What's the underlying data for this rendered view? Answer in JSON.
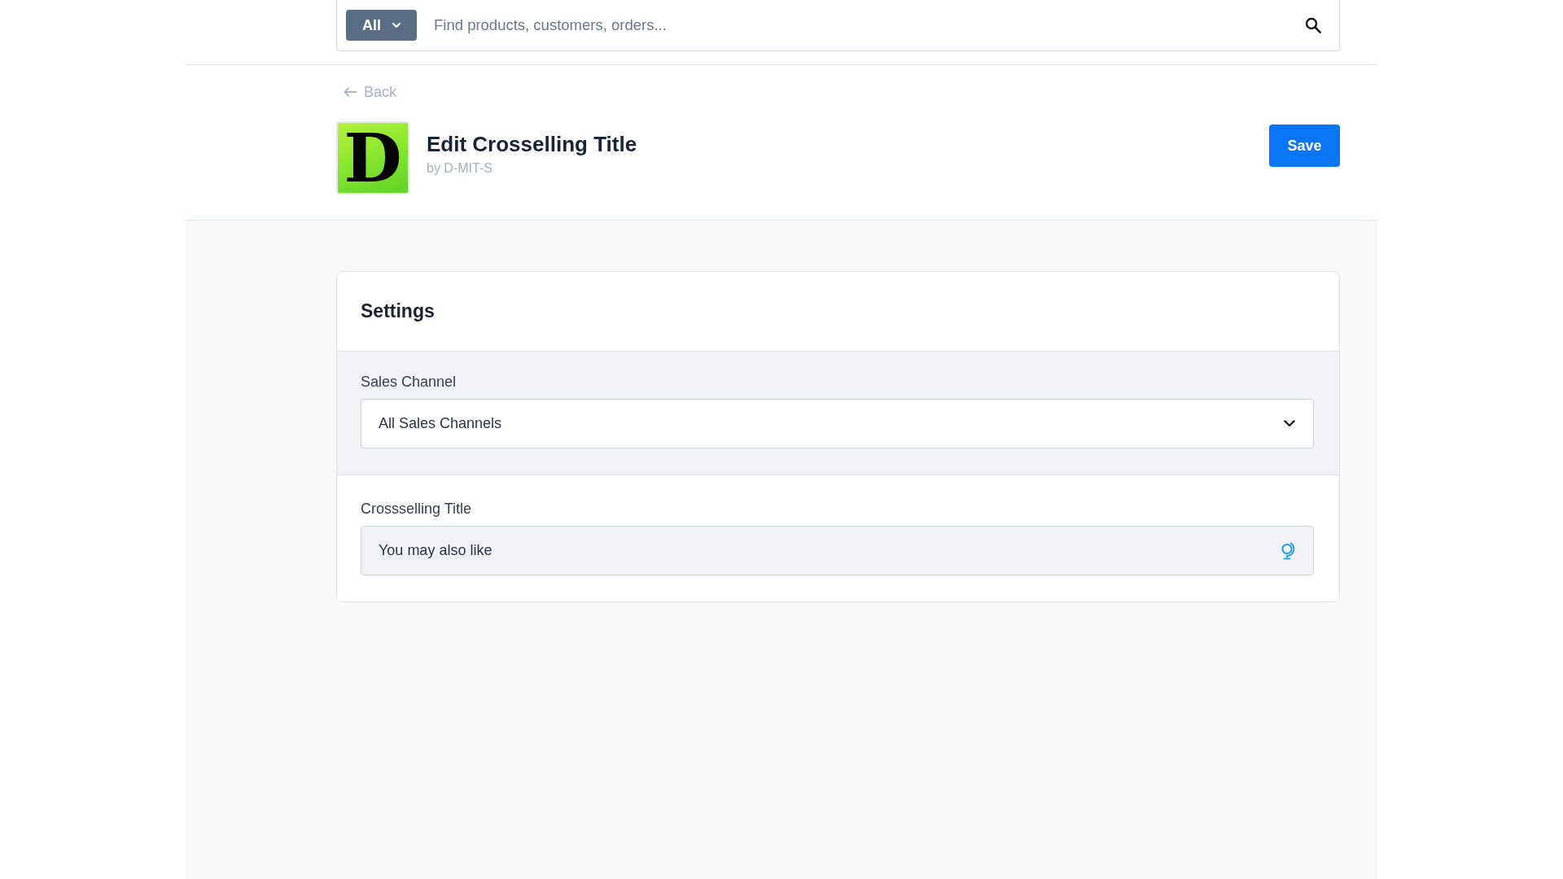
{
  "search": {
    "scope": "All",
    "placeholder": "Find products, customers, orders..."
  },
  "back_link": "Back",
  "app": {
    "logo_text": "D",
    "title": "Edit Crosselling Title",
    "author": "by D-MIT-S"
  },
  "save_button": "Save",
  "settings_card": {
    "title": "Settings",
    "sections": [
      {
        "kind": "sales_channel",
        "label": "Sales Channel",
        "value": "All Sales Channels"
      },
      {
        "kind": "text",
        "label": "Crossselling Title",
        "value": "You may also like"
      }
    ]
  }
}
